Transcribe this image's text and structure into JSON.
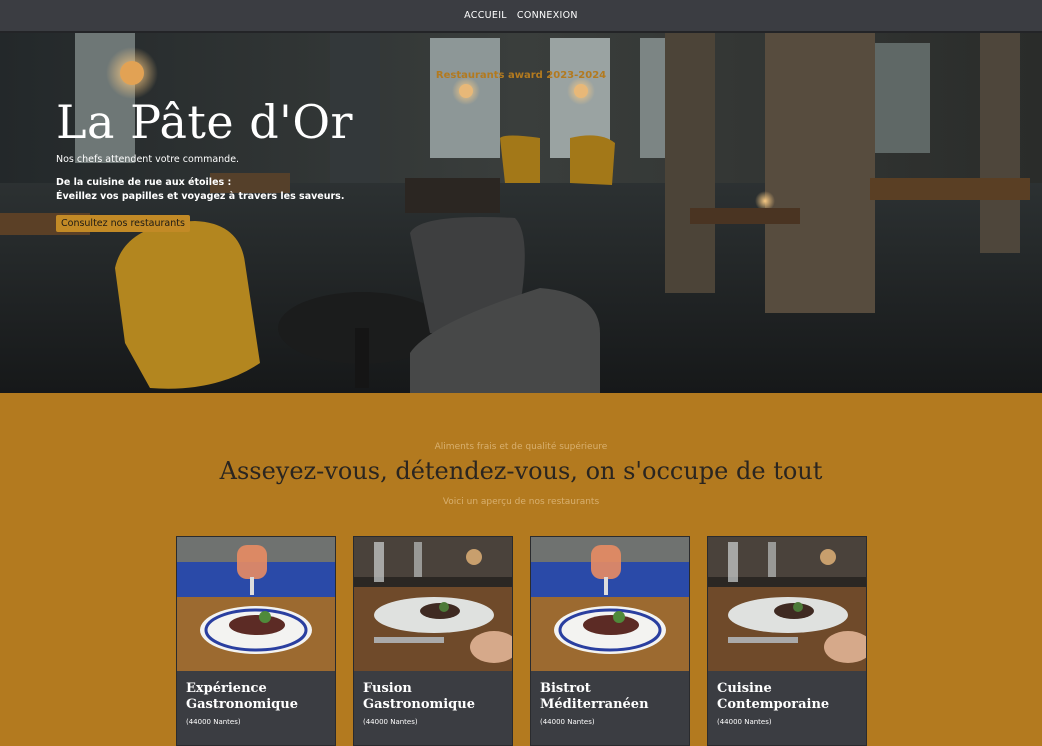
{
  "nav": {
    "items": [
      {
        "label": "ACCUEIL"
      },
      {
        "label": "CONNEXION"
      }
    ]
  },
  "hero": {
    "award": "Restaurants award 2023-2024",
    "title": "La Pâte d'Or",
    "subtitle": "Nos chefs attendent votre commande.",
    "tagline_1": "De la cuisine de rue aux étoiles :",
    "tagline_2": "Éveillez vos papilles et voyagez à travers les saveurs.",
    "cta_label": "Consultez nos restaurants"
  },
  "section": {
    "kicker": "Aliments frais et de qualité supérieure",
    "title": "Asseyez-vous, détendez-vous, on s'occupe de tout",
    "subtitle": "Voici un aperçu de nos restaurants"
  },
  "restaurants": [
    {
      "name": "Expérience Gastronomique",
      "location": "(44000 Nantes)",
      "photo": "cocktail-dish-photo"
    },
    {
      "name": "Fusion Gastronomique",
      "location": "(44000 Nantes)",
      "photo": "table-dish-photo"
    },
    {
      "name": "Bistrot Méditerranéen",
      "location": "(44000 Nantes)",
      "photo": "cocktail-dish-photo"
    },
    {
      "name": "Cuisine Contemporaine",
      "location": "(44000 Nantes)",
      "photo": "table-dish-photo"
    }
  ],
  "colors": {
    "accent": "#b37a1f",
    "button": "#c28a26",
    "nav_bg": "#3b3d42",
    "card_bg": "#3b3d42"
  }
}
